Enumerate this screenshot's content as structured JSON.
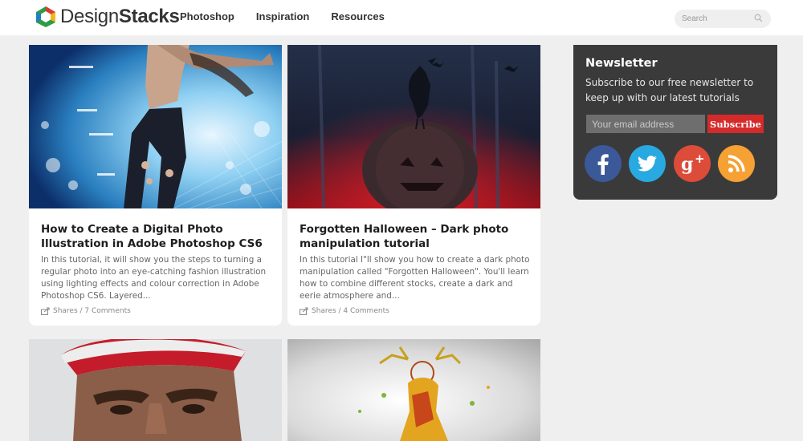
{
  "brand": {
    "part1": "Design",
    "part2": "Stacks"
  },
  "nav": [
    {
      "label": "Photoshop"
    },
    {
      "label": "Inspiration"
    },
    {
      "label": "Resources"
    }
  ],
  "search": {
    "placeholder": "Search"
  },
  "posts": [
    {
      "title": "How to Create a Digital Photo Illustration in Adobe Photoshop CS6",
      "excerpt": "In this tutorial, it will show you the steps to turning a regular photo into an eye-catching fashion illustration using lighting effects and colour correction in Adobe Photoshop CS6. Layered...",
      "meta": "Shares / 7 Comments"
    },
    {
      "title": "Forgotten Halloween – Dark photo manipulation tutorial",
      "excerpt": "In this tutorial I\"ll show you how to create a dark photo manipulation called \"Forgotten Halloween\". You'll learn how to combine different stocks, create a dark and eerie atmosphere and...",
      "meta": "Shares / 4 Comments"
    }
  ],
  "newsletter": {
    "title": "Newsletter",
    "text": "Subscribe to our free newsletter to keep up with our latest tutorials",
    "email_placeholder": "Your email address",
    "button": "Subscribe"
  },
  "social": [
    {
      "icon": "facebook-icon",
      "color": "#3b5998"
    },
    {
      "icon": "twitter-icon",
      "color": "#29a9e1"
    },
    {
      "icon": "google-plus-icon",
      "color": "#dd4b39"
    },
    {
      "icon": "rss-icon",
      "color": "#f6a134"
    }
  ]
}
